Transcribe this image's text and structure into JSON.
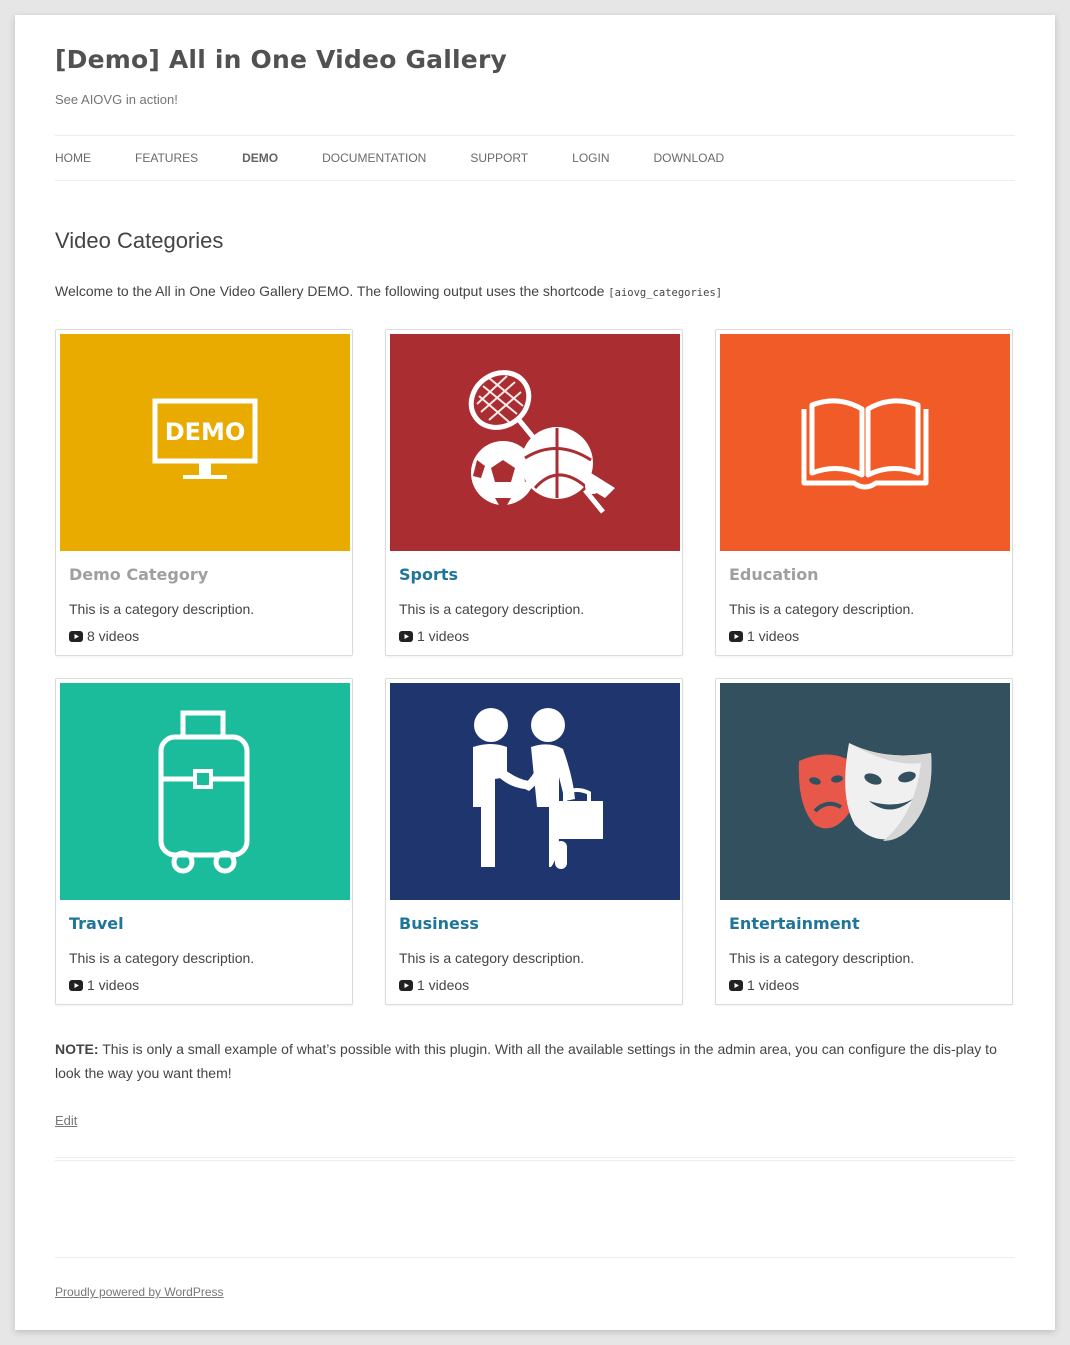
{
  "site": {
    "title": "[Demo] All in One Video Gallery",
    "description": "See AIOVG in action!"
  },
  "nav": {
    "items": [
      {
        "label": "HOME"
      },
      {
        "label": "FEATURES"
      },
      {
        "label": "DEMO",
        "current": true
      },
      {
        "label": "DOCUMENTATION"
      },
      {
        "label": "SUPPORT"
      },
      {
        "label": "LOGIN"
      },
      {
        "label": "DOWNLOAD"
      }
    ]
  },
  "main": {
    "title": "Video Categories",
    "intro": "Welcome to the All in One Video Gallery DEMO. The following output uses the shortcode",
    "shortcode": "[aiovg_categories]",
    "categories": [
      {
        "name": "Demo Category",
        "description": "This is a category description.",
        "count": "8 videos",
        "bg": "#e9ab00",
        "icon": "demo-monitor-icon",
        "icon_text": "DEMO"
      },
      {
        "name": "Sports",
        "description": "This is a category description.",
        "count": "1 videos",
        "bg": "#a92d31",
        "icon": "sports-balls-icon"
      },
      {
        "name": "Education",
        "description": "This is a category description.",
        "count": "1 videos",
        "bg": "#f15b27",
        "icon": "open-book-icon"
      },
      {
        "name": "Travel",
        "description": "This is a category description.",
        "count": "1 videos",
        "bg": "#1bbc9b",
        "icon": "suitcase-icon"
      },
      {
        "name": "Business",
        "description": "This is a category description.",
        "count": "1 videos",
        "bg": "#1e356e",
        "icon": "handshake-icon"
      },
      {
        "name": "Entertainment",
        "description": "This is a category description.",
        "count": "1 videos",
        "bg": "#33505e",
        "icon": "theater-masks-icon"
      }
    ],
    "note_label": "NOTE:",
    "note_text": "This is only a small example of what’s possible with this plugin. With all the available settings in the admin area, you can configure the dis-play to look the way you want them!",
    "edit_label": "Edit"
  },
  "footer": {
    "credit": "Proudly powered by WordPress"
  },
  "colors": {
    "link": "#21759b",
    "muted_title": "#9f9f9f",
    "text": "#444444"
  }
}
